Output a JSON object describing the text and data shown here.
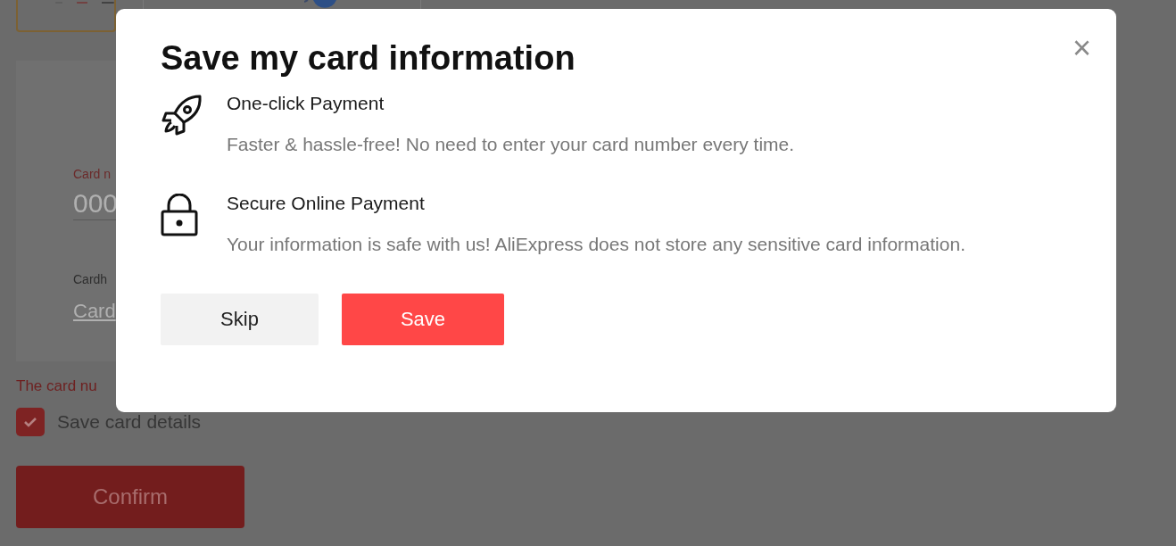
{
  "checkout": {
    "card_form": {
      "card_number_label": "Card n",
      "card_number_placeholder": "000",
      "cardholder_label": "Cardh",
      "cardholder_placeholder": "Card"
    },
    "error": "The card nu",
    "save_card": {
      "label": "Save card details",
      "checked": true
    },
    "confirm_button": "Confirm"
  },
  "dialog": {
    "title": "Save my card information",
    "close": "×",
    "features": [
      {
        "kind": "rocket",
        "title": "One-click Payment",
        "description": "Faster & hassle-free! No need to enter your card number every time."
      },
      {
        "kind": "lock",
        "title": "Secure Online Payment",
        "description": "Your information is safe with us! AliExpress does not store any sensitive card information."
      }
    ],
    "buttons": [
      {
        "kind": "secondary",
        "label": "Skip"
      },
      {
        "kind": "primary",
        "label": "Save"
      }
    ]
  }
}
